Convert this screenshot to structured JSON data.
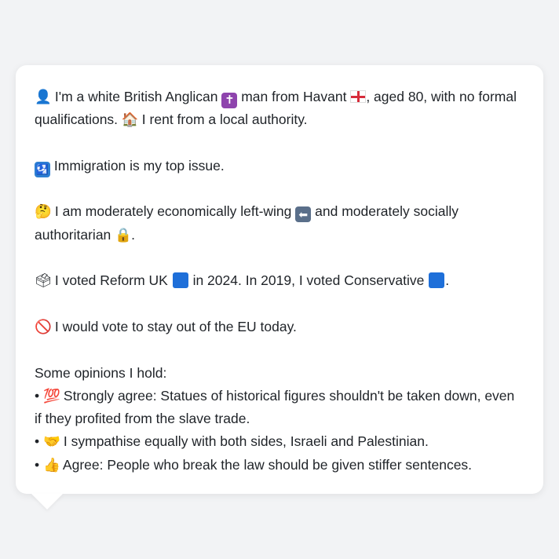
{
  "profile": {
    "intro": {
      "icon": "person-icon",
      "part1": "I'm a white British Anglican",
      "cross_icon": "latin-cross-icon",
      "part2": "man from Havant",
      "flag_icon": "england-flag-icon",
      "part3": ", aged 80, with no formal qualifications.",
      "house_icon": "house-icon",
      "part4": "I rent from a local authority."
    },
    "top_issue": {
      "icon": "passport-control-icon",
      "text": "Immigration is my top issue."
    },
    "politics": {
      "icon": "thinking-face-icon",
      "part1": "I am moderately economically left-wing",
      "arrow_icon": "left-arrow-icon",
      "part2": "and moderately socially authoritarian",
      "lock_icon": "lock-icon",
      "part3": "."
    },
    "votes": {
      "icon": "ballot-box-icon",
      "part1": "I voted Reform UK",
      "part2": "in 2024. In 2019, I voted Conservative",
      "part3": ".",
      "reform_color": "#1e6fd9",
      "conservative_color": "#1e6fd9"
    },
    "eu": {
      "icon": "prohibited-icon",
      "text": "I would vote to stay out of the EU today."
    },
    "opinions": {
      "heading": "Some opinions I hold:",
      "bullet": "•",
      "items": [
        {
          "icon": "hundred-points-icon",
          "text": "Strongly agree: Statues of historical figures shouldn't be taken down, even if they profited from the slave trade."
        },
        {
          "icon": "handshake-icon",
          "text": "I sympathise equally with both sides, Israeli and Palestinian."
        },
        {
          "icon": "thumbs-up-icon",
          "text": "Agree: People who break the law should be given stiffer sentences."
        }
      ]
    }
  }
}
